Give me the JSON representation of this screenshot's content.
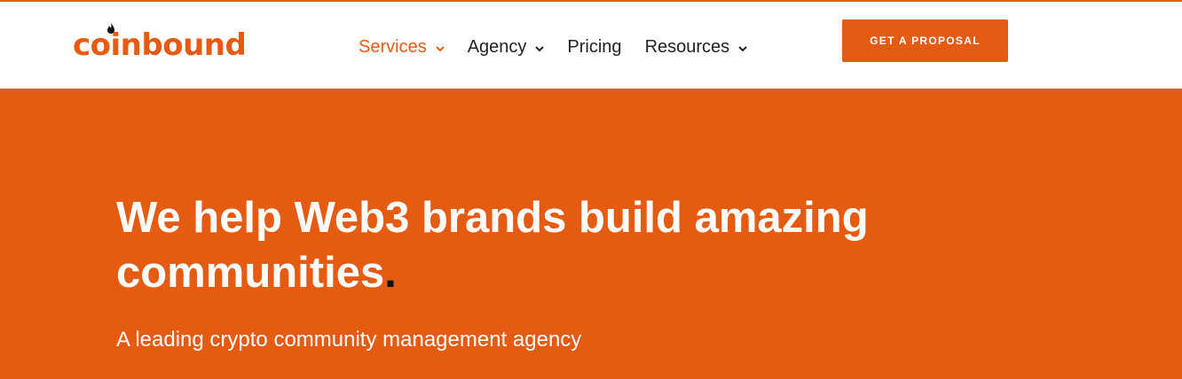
{
  "brand": {
    "name": "coinbound",
    "accent_color": "#e55b13"
  },
  "nav": {
    "items": [
      {
        "label": "Services",
        "has_dropdown": true,
        "active": true
      },
      {
        "label": "Agency",
        "has_dropdown": true,
        "active": false
      },
      {
        "label": "Pricing",
        "has_dropdown": false,
        "active": false
      },
      {
        "label": "Resources",
        "has_dropdown": true,
        "active": false
      }
    ],
    "dropdown_icon": "chevron-down-icon"
  },
  "cta": {
    "label": "GET A PROPOSAL"
  },
  "hero": {
    "title": "We help Web3 brands build amazing communities",
    "title_end": ".",
    "subtitle": "A leading crypto community management agency",
    "background_color": "#e55b11"
  }
}
